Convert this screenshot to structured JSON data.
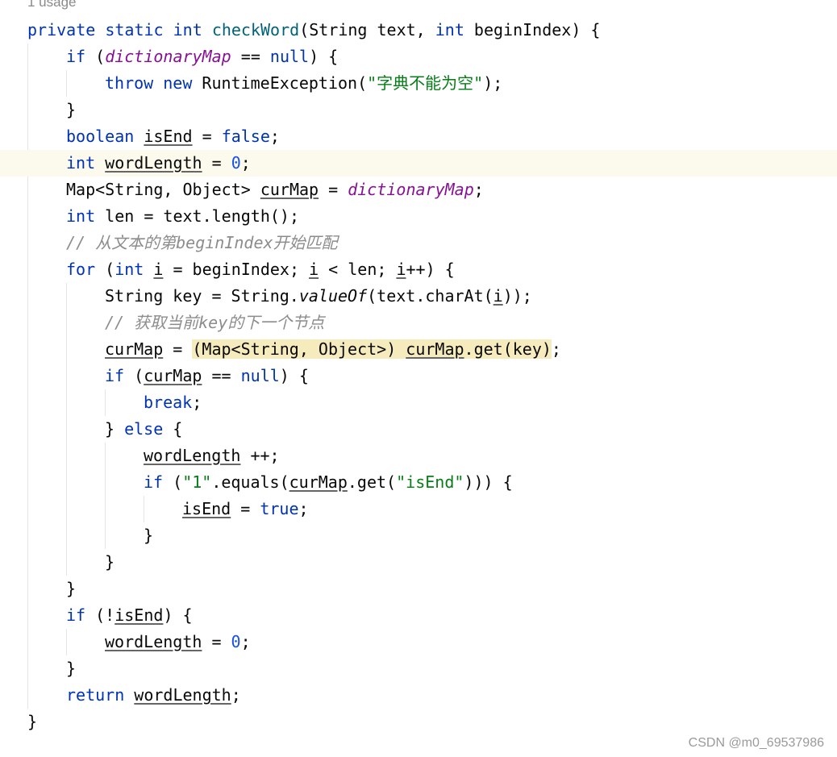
{
  "editor": {
    "usage_hint": "1 usage",
    "colors": {
      "keyword": "#0033b3",
      "method_declaration": "#00627a",
      "static_field": "#871094",
      "string": "#067d17",
      "number": "#1750eb",
      "comment": "#8c8c8c",
      "current_line_background": "#fcfaed",
      "highlight_background": "#f6ebbc"
    },
    "lines": [
      {
        "indent": 0,
        "tokens": [
          [
            "private",
            "kw"
          ],
          [
            " ",
            ""
          ],
          [
            "static",
            "kw"
          ],
          [
            " ",
            ""
          ],
          [
            "int",
            "kw"
          ],
          [
            " ",
            ""
          ],
          [
            "checkWord",
            "fn"
          ],
          [
            "(String text, ",
            ""
          ],
          [
            "int",
            "kw"
          ],
          [
            " beginIndex) {",
            ""
          ]
        ]
      },
      {
        "indent": 1,
        "tokens": [
          [
            "if",
            "kw"
          ],
          [
            " (",
            ""
          ],
          [
            "dictionaryMap",
            "field"
          ],
          [
            " == ",
            ""
          ],
          [
            "null",
            "kw"
          ],
          [
            ") {",
            ""
          ]
        ]
      },
      {
        "indent": 2,
        "tokens": [
          [
            "throw",
            "kw"
          ],
          [
            " ",
            ""
          ],
          [
            "new",
            "kw"
          ],
          [
            " RuntimeException(",
            ""
          ],
          [
            "\"字典不能为空\"",
            "str"
          ],
          [
            ");",
            ""
          ]
        ]
      },
      {
        "indent": 1,
        "tokens": [
          [
            "}",
            ""
          ]
        ]
      },
      {
        "indent": 1,
        "tokens": [
          [
            "boolean",
            "kw"
          ],
          [
            " ",
            ""
          ],
          [
            "isEnd",
            "u"
          ],
          [
            " = ",
            ""
          ],
          [
            "false",
            "kw"
          ],
          [
            ";",
            ""
          ]
        ]
      },
      {
        "indent": 1,
        "current": true,
        "tokens": [
          [
            "int",
            "kw"
          ],
          [
            " ",
            ""
          ],
          [
            "wordLength",
            "u"
          ],
          [
            " = ",
            ""
          ],
          [
            "0",
            "num"
          ],
          [
            ";",
            ""
          ]
        ]
      },
      {
        "indent": 1,
        "tokens": [
          [
            "Map<String, Object> ",
            ""
          ],
          [
            "curMap",
            "u"
          ],
          [
            " = ",
            ""
          ],
          [
            "dictionaryMap",
            "field"
          ],
          [
            ";",
            ""
          ]
        ]
      },
      {
        "indent": 1,
        "tokens": [
          [
            "int",
            "kw"
          ],
          [
            " len = text.length();",
            ""
          ]
        ]
      },
      {
        "indent": 1,
        "tokens": [
          [
            "// 从文本的第beginIndex开始匹配",
            "cm"
          ]
        ]
      },
      {
        "indent": 1,
        "tokens": [
          [
            "for",
            "kw"
          ],
          [
            " (",
            ""
          ],
          [
            "int",
            "kw"
          ],
          [
            " ",
            ""
          ],
          [
            "i",
            "u"
          ],
          [
            " = beginIndex; ",
            ""
          ],
          [
            "i",
            "u"
          ],
          [
            " < len; ",
            ""
          ],
          [
            "i",
            "u"
          ],
          [
            "++) {",
            ""
          ]
        ]
      },
      {
        "indent": 2,
        "tokens": [
          [
            "String key = String.",
            ""
          ],
          [
            "valueOf",
            "sm"
          ],
          [
            "(text.charAt(",
            ""
          ],
          [
            "i",
            "u"
          ],
          [
            "));",
            ""
          ]
        ]
      },
      {
        "indent": 2,
        "tokens": [
          [
            "// 获取当前key的下一个节点",
            "cm"
          ]
        ]
      },
      {
        "indent": 2,
        "tokens": [
          [
            "curMap",
            "u"
          ],
          [
            " = ",
            ""
          ],
          [
            "(Map<String, Object>) ",
            "hl"
          ],
          [
            "curMap",
            "u hl"
          ],
          [
            ".get(key)",
            "hl"
          ],
          [
            ";",
            ""
          ]
        ]
      },
      {
        "indent": 2,
        "tokens": [
          [
            "if",
            "kw"
          ],
          [
            " (",
            ""
          ],
          [
            "curMap",
            "u"
          ],
          [
            " == ",
            ""
          ],
          [
            "null",
            "kw"
          ],
          [
            ") {",
            ""
          ]
        ]
      },
      {
        "indent": 3,
        "tokens": [
          [
            "break",
            "kw"
          ],
          [
            ";",
            ""
          ]
        ]
      },
      {
        "indent": 2,
        "tokens": [
          [
            "} ",
            ""
          ],
          [
            "else",
            "kw"
          ],
          [
            " {",
            ""
          ]
        ]
      },
      {
        "indent": 3,
        "tokens": [
          [
            "wordLength",
            "u"
          ],
          [
            " ++;",
            ""
          ]
        ]
      },
      {
        "indent": 3,
        "tokens": [
          [
            "if",
            "kw"
          ],
          [
            " (",
            ""
          ],
          [
            "\"1\"",
            "str"
          ],
          [
            ".equals(",
            ""
          ],
          [
            "curMap",
            "u"
          ],
          [
            ".get(",
            ""
          ],
          [
            "\"isEnd\"",
            "str"
          ],
          [
            "))) {",
            ""
          ]
        ]
      },
      {
        "indent": 4,
        "tokens": [
          [
            "isEnd",
            "u"
          ],
          [
            " = ",
            ""
          ],
          [
            "true",
            "kw"
          ],
          [
            ";",
            ""
          ]
        ]
      },
      {
        "indent": 3,
        "tokens": [
          [
            "}",
            ""
          ]
        ]
      },
      {
        "indent": 2,
        "tokens": [
          [
            "}",
            ""
          ]
        ]
      },
      {
        "indent": 1,
        "tokens": [
          [
            "}",
            ""
          ]
        ]
      },
      {
        "indent": 1,
        "tokens": [
          [
            "if",
            "kw"
          ],
          [
            " (!",
            ""
          ],
          [
            "isEnd",
            "u"
          ],
          [
            ") {",
            ""
          ]
        ]
      },
      {
        "indent": 2,
        "tokens": [
          [
            "wordLength",
            "u"
          ],
          [
            " = ",
            ""
          ],
          [
            "0",
            "num"
          ],
          [
            ";",
            ""
          ]
        ]
      },
      {
        "indent": 1,
        "tokens": [
          [
            "}",
            ""
          ]
        ]
      },
      {
        "indent": 1,
        "tokens": [
          [
            "return",
            "kw"
          ],
          [
            " ",
            ""
          ],
          [
            "wordLength",
            "u"
          ],
          [
            ";",
            ""
          ]
        ]
      },
      {
        "indent": 0,
        "tokens": [
          [
            "}",
            ""
          ]
        ]
      }
    ]
  },
  "watermark": "CSDN @m0_69537986"
}
